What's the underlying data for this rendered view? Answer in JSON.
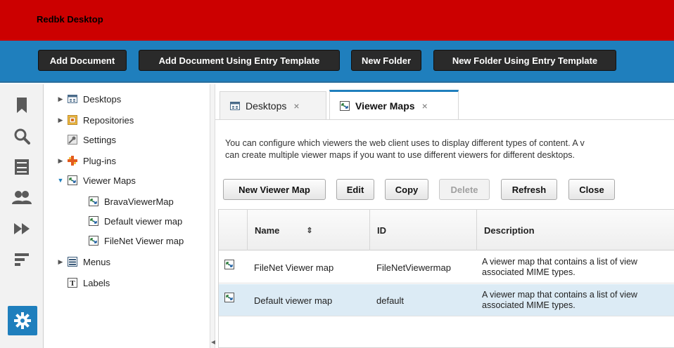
{
  "app": {
    "title": "Redbk Desktop"
  },
  "toolbar": {
    "buttons": [
      "Add Document",
      "Add Document Using Entry Template",
      "New Folder",
      "New Folder Using Entry Template"
    ]
  },
  "rail": {
    "icons": [
      "bookmark-icon",
      "search-icon",
      "cabinet-icon",
      "users-icon",
      "forward-icon",
      "list-icon",
      "gear-icon"
    ],
    "accent": "#1f7fbd"
  },
  "tree": {
    "items": [
      {
        "label": "Desktops",
        "expandable": true,
        "icon": "desktops-icon"
      },
      {
        "label": "Repositories",
        "expandable": true,
        "icon": "repository-icon"
      },
      {
        "label": "Settings",
        "expandable": false,
        "icon": "settings-icon"
      },
      {
        "label": "Plug-ins",
        "expandable": true,
        "icon": "plugin-icon"
      },
      {
        "label": "Viewer Maps",
        "expandable": true,
        "expanded": true,
        "icon": "viewer-map-icon"
      },
      {
        "label": "BravaViewerMap",
        "child": true,
        "icon": "viewer-map-icon"
      },
      {
        "label": "Default viewer map",
        "child": true,
        "icon": "viewer-map-icon"
      },
      {
        "label": "FileNet Viewer map",
        "child": true,
        "icon": "viewer-map-icon"
      },
      {
        "label": "Menus",
        "expandable": true,
        "icon": "menu-icon"
      },
      {
        "label": "Labels",
        "expandable": false,
        "icon": "label-icon"
      }
    ]
  },
  "tabs": [
    {
      "label": "Desktops",
      "close": "×",
      "active": false
    },
    {
      "label": "Viewer Maps",
      "close": "×",
      "active": true
    }
  ],
  "description": {
    "line1": "You can configure which viewers the web client uses to display different types of content. A v",
    "line2": "can create multiple viewer maps if you want to use different viewers for different desktops."
  },
  "buttons": {
    "new": "New Viewer Map",
    "edit": "Edit",
    "copy": "Copy",
    "delete": "Delete",
    "refresh": "Refresh",
    "close": "Close"
  },
  "grid": {
    "columns": {
      "name": "Name",
      "sort": "⇕",
      "id": "ID",
      "description": "Description"
    },
    "rows": [
      {
        "name": "FileNet Viewer map",
        "id": "FileNetViewermap",
        "desc1": "A viewer map that contains a list of view",
        "desc2": "associated MIME types.",
        "selected": false
      },
      {
        "name": "Default viewer map",
        "id": "default",
        "desc1": "A viewer map that contains a list of view",
        "desc2": "associated MIME types.",
        "selected": true
      }
    ]
  }
}
